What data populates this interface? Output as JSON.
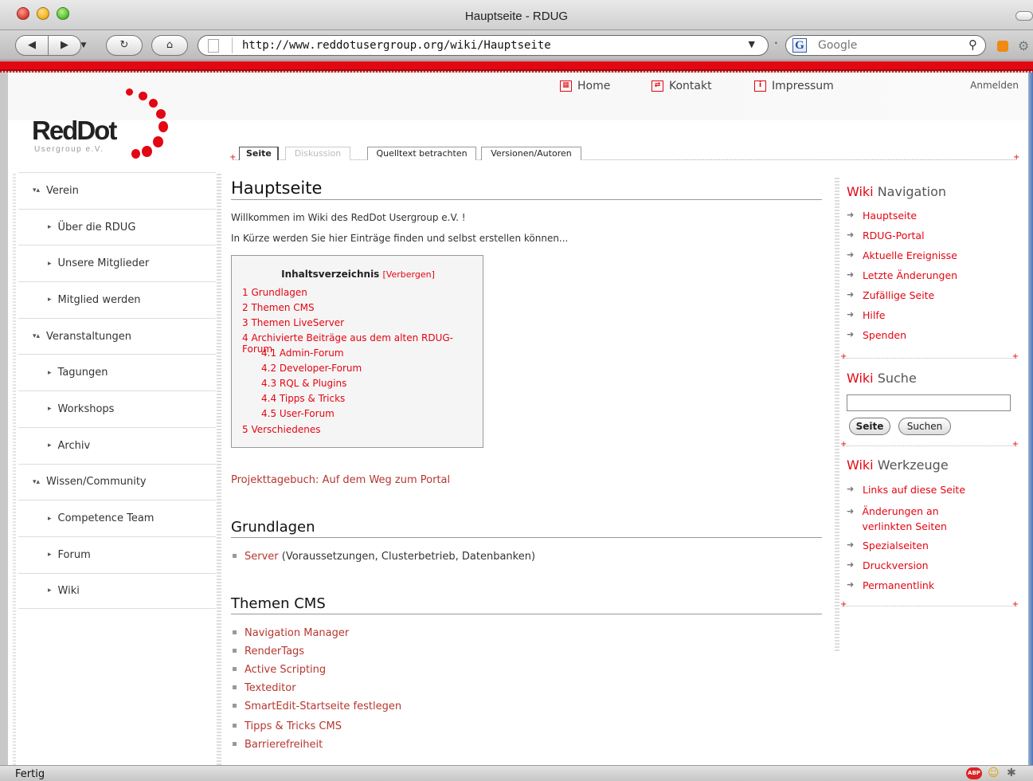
{
  "browser": {
    "window_title": "Hauptseite - RDUG",
    "url": "http://www.reddotusergroup.org/wiki/Hauptseite",
    "search_placeholder": "Google",
    "status": "Fertig"
  },
  "site": {
    "logo_text": "RedDot",
    "logo_sub": "Usergroup e.V.",
    "top_nav": [
      "Home",
      "Kontakt",
      "Impressum"
    ],
    "login": "Anmelden"
  },
  "tabs": [
    "Seite",
    "Diskussion",
    "Quelltext betrachten",
    "Versionen/Autoren"
  ],
  "sidebar": [
    {
      "label": "Verein",
      "level": 0
    },
    {
      "label": "Über die RDUG",
      "level": 1
    },
    {
      "label": "Unsere Mitglieder",
      "level": 1
    },
    {
      "label": "Mitglied werden",
      "level": 1
    },
    {
      "label": "Veranstaltungen",
      "level": 0
    },
    {
      "label": "Tagungen",
      "level": 1
    },
    {
      "label": "Workshops",
      "level": 1
    },
    {
      "label": "Archiv",
      "level": 1
    },
    {
      "label": "Wissen/Community",
      "level": 0
    },
    {
      "label": "Competence Team",
      "level": 1
    },
    {
      "label": "Forum",
      "level": 1
    },
    {
      "label": "Wiki",
      "level": 1
    }
  ],
  "main": {
    "title": "Hauptseite",
    "intro1": "Willkommen im Wiki des RedDot Usergroup e.V. !",
    "intro2": "In Kürze werden Sie hier Einträge finden und selbst erstellen können...",
    "toc": {
      "title": "Inhaltsverzeichnis",
      "hide": "[Verbergen]",
      "items": [
        {
          "label": "1 Grundlagen",
          "indent": 0
        },
        {
          "label": "2 Themen CMS",
          "indent": 0
        },
        {
          "label": "3 Themen LiveServer",
          "indent": 0
        },
        {
          "label": "4 Archivierte Beiträge aus dem alten RDUG-Forum",
          "indent": 0
        },
        {
          "label": "4.1 Admin-Forum",
          "indent": 1
        },
        {
          "label": "4.2 Developer-Forum",
          "indent": 1
        },
        {
          "label": "4.3 RQL & Plugins",
          "indent": 1
        },
        {
          "label": "4.4 Tipps & Tricks",
          "indent": 1
        },
        {
          "label": "4.5 User-Forum",
          "indent": 1
        },
        {
          "label": "5 Verschiedenes",
          "indent": 0
        }
      ]
    },
    "project_link": "Projekttagebuch: Auf dem Weg zum Portal",
    "section_grundlagen": "Grundlagen",
    "grundlagen_item": {
      "link": "Server",
      "rest": " (Voraussetzungen, Clusterbetrieb, Datenbanken)"
    },
    "section_cms": "Themen CMS",
    "cms_items": [
      "Navigation Manager",
      "RenderTags",
      "Active Scripting",
      "Texteditor",
      "SmartEdit-Startseite festlegen",
      "Tipps & Tricks CMS",
      "Barrierefreiheit"
    ]
  },
  "right": {
    "nav_head_red": "Wiki",
    "nav_head_rest": " Navigation",
    "nav_links": [
      "Hauptseite",
      "RDUG-Portal",
      "Aktuelle Ereignisse",
      "Letzte Änderungen",
      "Zufällige Seite",
      "Hilfe",
      "Spenden"
    ],
    "search_head_red": "Wiki",
    "search_head_rest": " Suche",
    "search_btn_page": "Seite",
    "search_btn_search": "Suchen",
    "tools_head_red": "Wiki",
    "tools_head_rest": " Werkzeuge",
    "tools_links": [
      "Links auf diese Seite",
      "Änderungen an verlinkten Seiten",
      "Spezialseiten",
      "Druckversion",
      "Permanentlink"
    ]
  }
}
